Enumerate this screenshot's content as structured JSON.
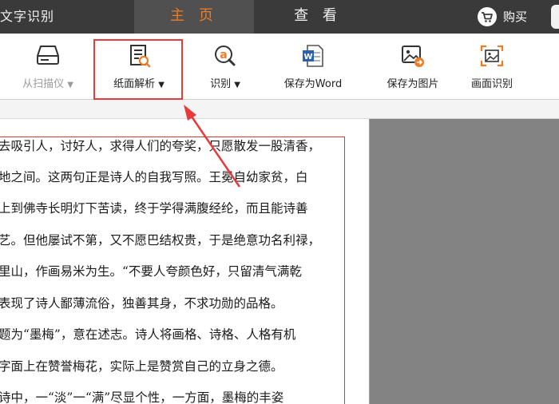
{
  "header": {
    "app_title": "文字识别",
    "tabs": [
      {
        "label": "主 页",
        "active": true
      },
      {
        "label": "查 看",
        "active": false
      }
    ],
    "buy_label": "购买"
  },
  "toolbar": {
    "scan_label": "从扫描仪",
    "paper_label": "纸面解析",
    "recognize_label": "识别",
    "save_word_label": "保存为Word",
    "save_image_label": "保存为图片",
    "screen_recog_label": "画面识别",
    "dropdown_glyph": "▼"
  },
  "document": {
    "lines": [
      "去吸引人，讨好人，求得人们的夸奖，只愿散发一股清香，",
      "地之间。这两句正是诗人的自我写照。王冕自幼家贫，白",
      "上到佛寺长明灯下苦读，终于学得满腹经纶，而且能诗善",
      "艺。但他屡试不第，又不愿巴结权贵，于是绝意功名利禄，",
      "里山，作画易米为生。“不要人夸颜色好，只留清气满乾",
      "表现了诗人鄙薄流俗，独善其身，不求功勋的品格。",
      "题为“墨梅”，意在述志。诗人将画格、诗格、人格有机",
      "  字面上在赞誉梅花，实际上是赞赏自己的立身之德。",
      "诗中，一“淡”一“满”尽显个性，一方面，墨梅的丰姿"
    ]
  },
  "colors": {
    "topbar": "#3a3a3a",
    "active_tab_text": "#f07b24",
    "highlight": "#e8393b",
    "preview_panel": "#838383"
  }
}
